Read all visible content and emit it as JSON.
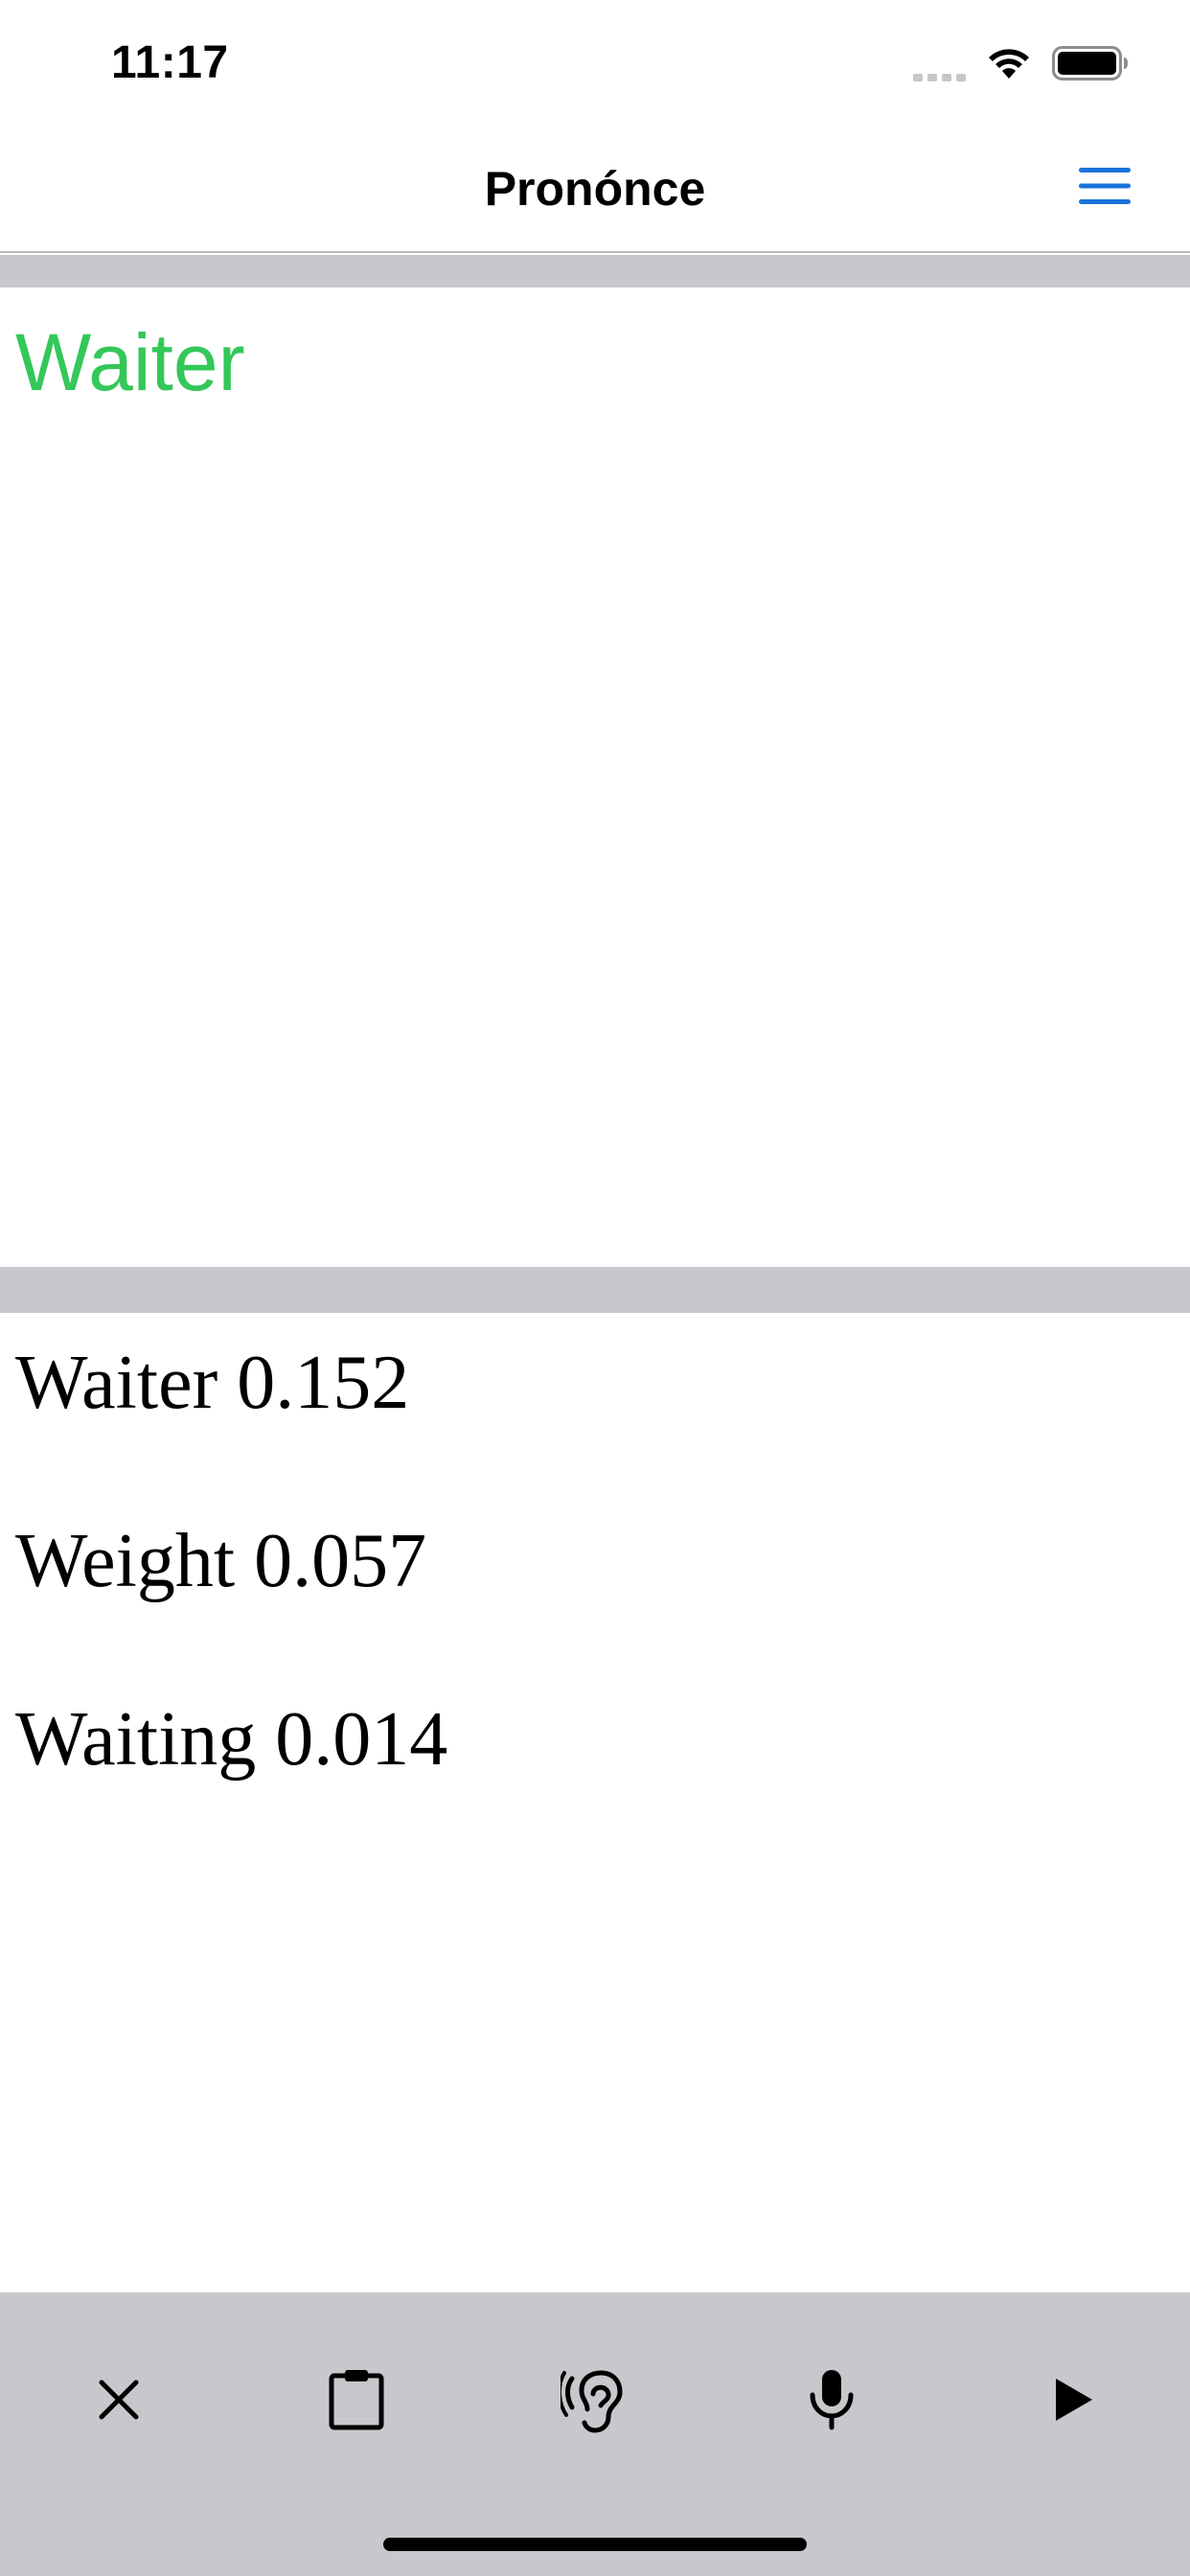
{
  "status_bar": {
    "time": "11:17",
    "icons": [
      "cellular-signal-icon",
      "wifi-icon",
      "battery-icon"
    ]
  },
  "nav": {
    "title": "Pronónce",
    "menu_icon": "hamburger-menu-icon",
    "accent_color": "#1a73d9"
  },
  "input": {
    "word": "Waiter",
    "color": "#34c759"
  },
  "results": [
    {
      "word": "Waiter",
      "score": "0.152",
      "text": "Waiter 0.152"
    },
    {
      "word": "Weight",
      "score": "0.057",
      "text": "Weight 0.057"
    },
    {
      "word": "Waiting",
      "score": "0.014",
      "text": "Waiting 0.014"
    }
  ],
  "toolbar": {
    "buttons": [
      {
        "icon": "close-icon"
      },
      {
        "icon": "clipboard-icon"
      },
      {
        "icon": "ear-listen-icon"
      },
      {
        "icon": "microphone-icon"
      },
      {
        "icon": "play-icon"
      }
    ],
    "background": "#c8c8cc"
  }
}
